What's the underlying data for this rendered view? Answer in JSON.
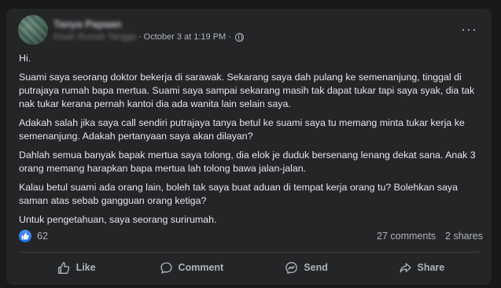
{
  "post": {
    "author_name": "Tanya Papaan",
    "group_name": "Kisah Rumah Tangga",
    "date": "October 3 at 1:19 PM",
    "separator": "·",
    "more_label": "···",
    "paragraphs": [
      "Hi.",
      "Suami saya seorang doktor bekerja di sarawak. Sekarang saya dah pulang ke semenanjung, tinggal di putrajaya rumah bapa mertua. Suami saya sampai sekarang masih tak dapat tukar tapi saya syak, dia tak nak tukar kerana pernah kantoi dia ada wanita lain selain saya.",
      "Adakah salah jika saya call sendiri putrajaya tanya betul ke suami saya tu memang minta tukar kerja ke semenanjung. Adakah pertanyaan saya akan dilayan?",
      "Dahlah semua banyak bapak mertua saya tolong, dia elok je duduk bersenang lenang dekat sana. Anak 3 orang memang harapkan bapa mertua lah tolong bawa jalan-jalan.",
      "Kalau betul suami ada orang lain, boleh tak saya buat aduan di tempat kerja orang tu? Bolehkan saya saman atas sebab gangguan orang ketiga?",
      "Untuk pengetahuan, saya seorang surirumah."
    ]
  },
  "stats": {
    "reactions": "62",
    "comments": "27 comments",
    "shares": "2 shares"
  },
  "actions": {
    "like": "Like",
    "comment": "Comment",
    "send": "Send",
    "share": "Share"
  },
  "colors": {
    "background": "#18191a",
    "card": "#242526",
    "text": "#e4e6eb",
    "secondary": "#b0b3b8",
    "like_blue": "#1a6fe8"
  }
}
